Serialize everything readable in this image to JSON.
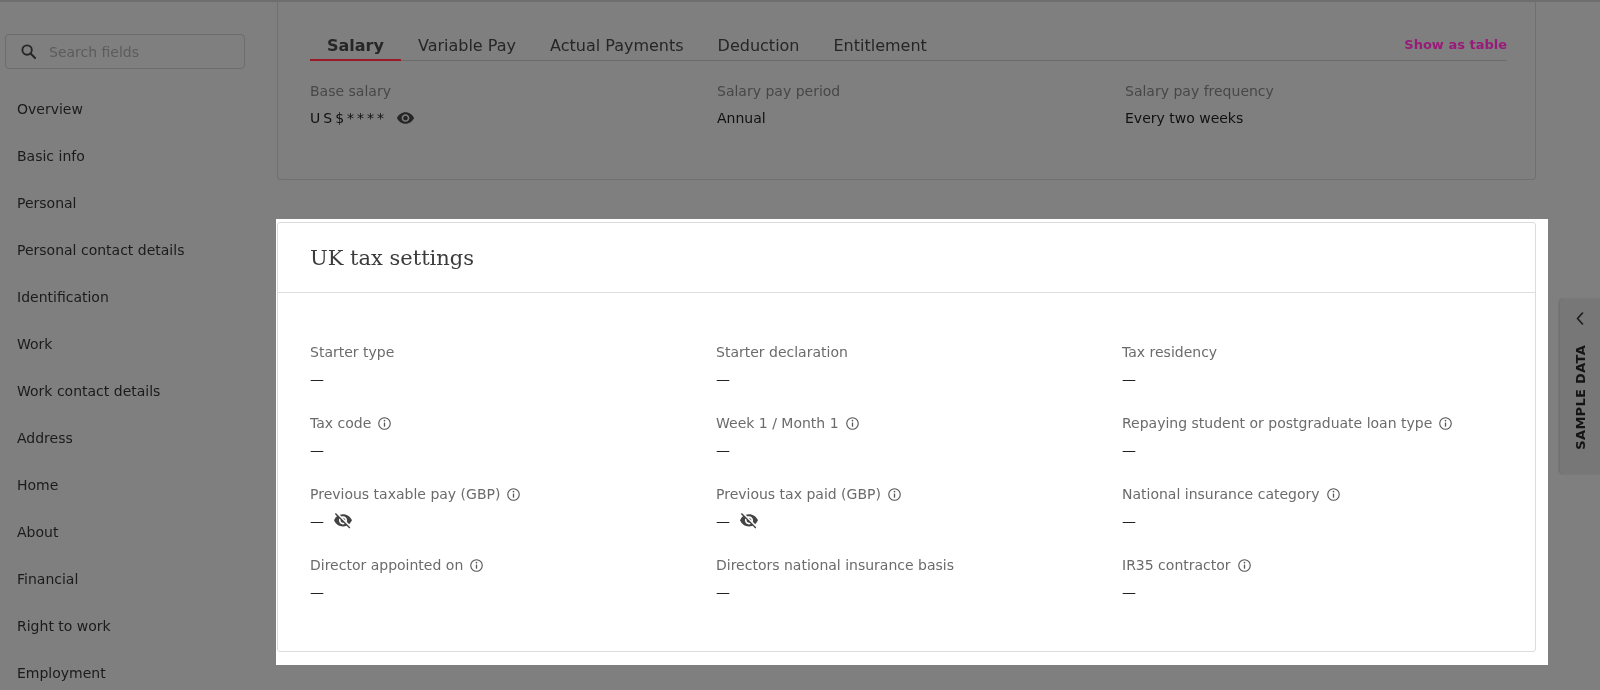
{
  "sidebar": {
    "search": {
      "placeholder": "Search fields"
    },
    "items": [
      {
        "label": "Overview"
      },
      {
        "label": "Basic info"
      },
      {
        "label": "Personal"
      },
      {
        "label": "Personal contact details"
      },
      {
        "label": "Identification"
      },
      {
        "label": "Work"
      },
      {
        "label": "Work contact details"
      },
      {
        "label": "Address"
      },
      {
        "label": "Home"
      },
      {
        "label": "About"
      },
      {
        "label": "Financial"
      },
      {
        "label": "Right to work"
      },
      {
        "label": "Employment"
      }
    ]
  },
  "salary_card": {
    "tabs": [
      {
        "label": "Salary",
        "selected": true
      },
      {
        "label": "Variable Pay",
        "selected": false
      },
      {
        "label": "Actual Payments",
        "selected": false
      },
      {
        "label": "Deduction",
        "selected": false
      },
      {
        "label": "Entitlement",
        "selected": false
      }
    ],
    "action": "Show as table",
    "fields": [
      {
        "label": "Base salary",
        "value": "US$****",
        "masked": true
      },
      {
        "label": "Salary pay period",
        "value": "Annual",
        "masked": false
      },
      {
        "label": "Salary pay frequency",
        "value": "Every two weeks",
        "masked": false
      }
    ]
  },
  "tax_card": {
    "title": "UK tax settings",
    "highlighted": true,
    "fields": [
      {
        "label": "Starter type",
        "value": "—",
        "info": false,
        "hidden": false
      },
      {
        "label": "Starter declaration",
        "value": "—",
        "info": false,
        "hidden": false
      },
      {
        "label": "Tax residency",
        "value": "—",
        "info": false,
        "hidden": false
      },
      {
        "label": "Tax code",
        "value": "—",
        "info": true,
        "hidden": false
      },
      {
        "label": "Week 1 / Month 1",
        "value": "—",
        "info": true,
        "hidden": false
      },
      {
        "label": "Repaying student or postgraduate loan type",
        "value": "—",
        "info": true,
        "hidden": false
      },
      {
        "label": "Previous taxable pay (GBP)",
        "value": "—",
        "info": true,
        "hidden": true
      },
      {
        "label": "Previous tax paid (GBP)",
        "value": "—",
        "info": true,
        "hidden": true
      },
      {
        "label": "National insurance category",
        "value": "—",
        "info": true,
        "hidden": false
      },
      {
        "label": "Director appointed on",
        "value": "—",
        "info": true,
        "hidden": false
      },
      {
        "label": "Directors national insurance basis",
        "value": "—",
        "info": false,
        "hidden": false
      },
      {
        "label": "IR35 contractor",
        "value": "—",
        "info": true,
        "hidden": false
      }
    ]
  },
  "side_tab": {
    "label": "SAMPLE DATA"
  }
}
